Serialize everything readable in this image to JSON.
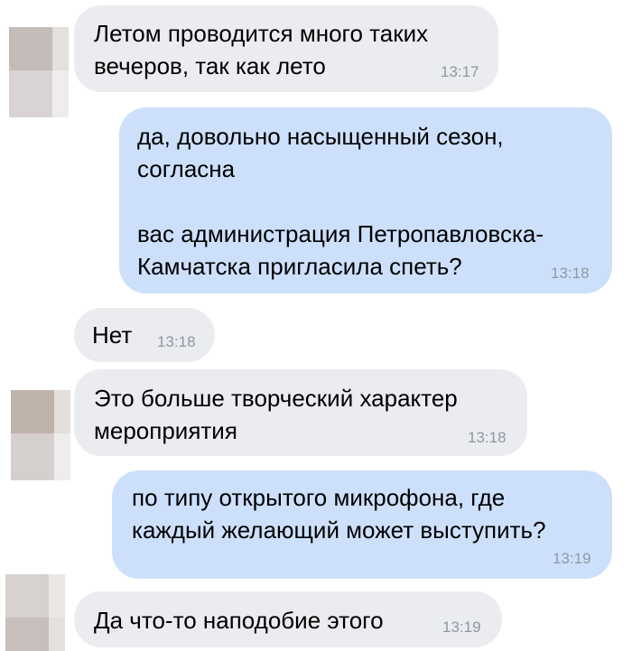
{
  "messages": [
    {
      "direction": "in",
      "text": "Летом проводится много таких\nвечеров, так как лето",
      "time": "13:17"
    },
    {
      "direction": "out",
      "text": "да, довольно насыщенный сезон,\nсогласна\n\nвас администрация Петропавловска-\nКамчатска пригласила спеть?",
      "time": "13:18"
    },
    {
      "direction": "in",
      "text": "Нет",
      "time": "13:18"
    },
    {
      "direction": "in",
      "text": "Это больше творческий характер\nмероприятия",
      "time": "13:18"
    },
    {
      "direction": "out",
      "text": "по типу открытого микрофона, где\nкаждый желающий может выступить?",
      "time": "13:19"
    },
    {
      "direction": "in",
      "text": "Да что-то наподобие этого",
      "time": "13:19"
    }
  ],
  "colors": {
    "incoming_bubble": "#ebecf0",
    "outgoing_bubble": "#cde0fb",
    "timestamp": "#8e97a3"
  }
}
